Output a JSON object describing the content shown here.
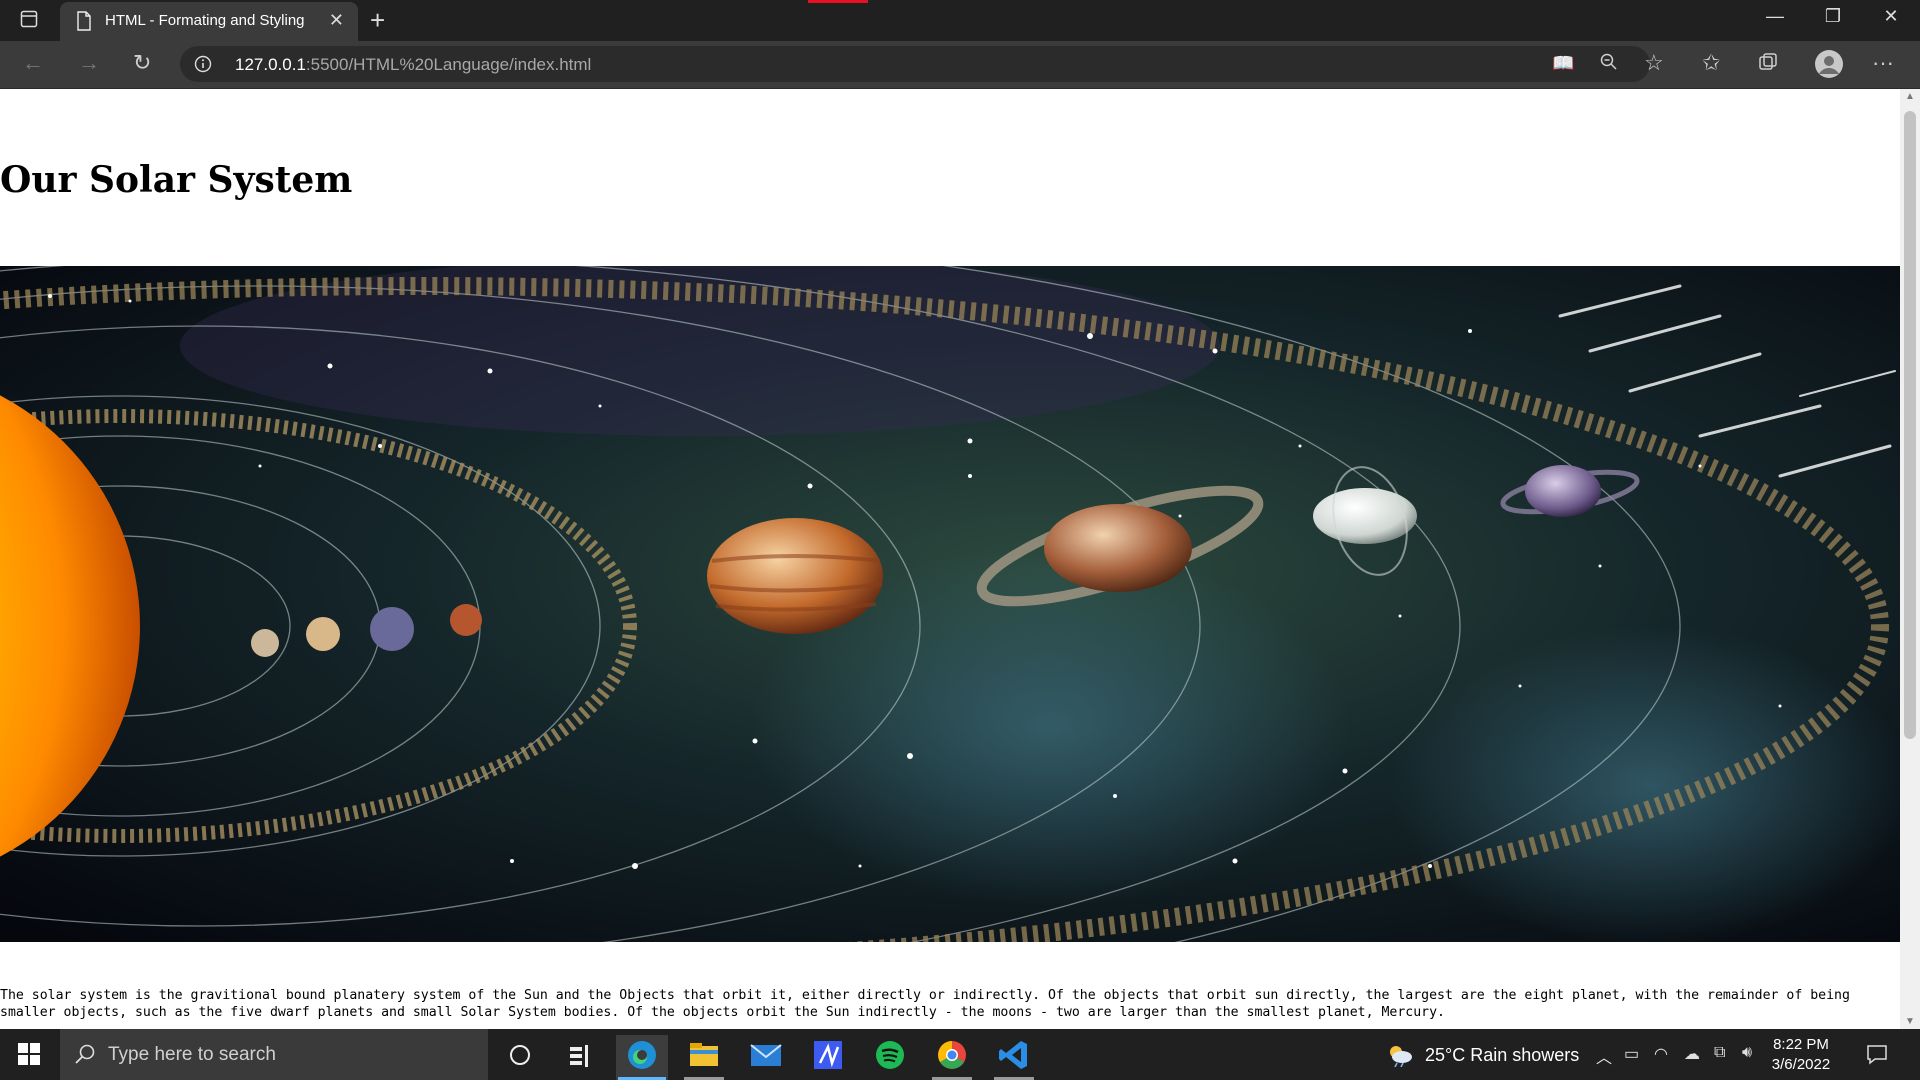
{
  "browser": {
    "tab_title": "HTML - Formating and Styling",
    "url_host": "127.0.0.1",
    "url_path": ":5500/HTML%20Language/index.html"
  },
  "page": {
    "heading": "Our Solar System",
    "paragraph": "The solar system is the gravitional bound planatery system of the Sun and the Objects that orbit it, either directly or indirectly. Of the objects that orbit sun directly, the largest are the eight planet, with the remainder of being smaller objects, such as the five dwarf planets and small Solar System bodies. Of the objects orbit the Sun indirectly - the moons - two are larger than the smallest planet, Mercury."
  },
  "taskbar": {
    "search_placeholder": "Type here to search",
    "weather": "25°C  Rain showers",
    "time": "8:22 PM",
    "date": "3/6/2022"
  },
  "colors": {
    "chrome_dark": "#202020",
    "toolbar": "#3b3b3b",
    "edge_accent": "#60b8ff",
    "spotify": "#1db954",
    "vscode": "#2b8ee6"
  }
}
